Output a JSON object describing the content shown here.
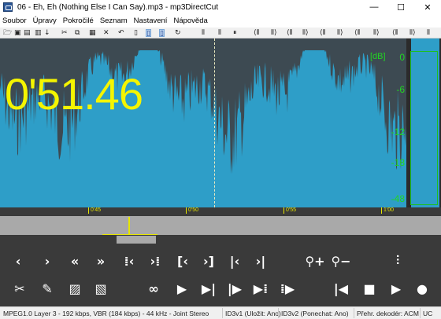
{
  "window": {
    "title": "06 - Eh, Eh (Nothing Else I Can Say).mp3 - mp3DirectCut",
    "minimize": "—",
    "maximize": "☐",
    "close": "✕"
  },
  "menu": [
    {
      "label": "Soubor"
    },
    {
      "label": "Úpravy"
    },
    {
      "label": "Pokročilé"
    },
    {
      "label": "Seznam"
    },
    {
      "label": "Nastavení"
    },
    {
      "label": "Nápověda"
    }
  ],
  "display": {
    "position": "0'51.46",
    "meter_unit": "[dB]",
    "meter_scale": [
      "0",
      "-6",
      "-12",
      "-18",
      "-48"
    ]
  },
  "ruler": {
    "labels": [
      "0'45",
      "0'50",
      "0'55",
      "1'00"
    ]
  },
  "controls": {
    "row1": [
      {
        "name": "prev-frame-button",
        "icon": "chevron-left-icon",
        "glyph": "‹"
      },
      {
        "name": "next-frame-button",
        "icon": "chevron-right-icon",
        "glyph": "›"
      },
      {
        "name": "rewind-button",
        "icon": "double-chevron-left-icon",
        "glyph": "«"
      },
      {
        "name": "forward-button",
        "icon": "double-chevron-right-icon",
        "glyph": "»"
      },
      {
        "name": "go-to-selection-start-button",
        "icon": "bar-left-icon",
        "glyph": "⁞‹"
      },
      {
        "name": "go-to-selection-end-button",
        "icon": "bar-right-icon",
        "glyph": "›⁞"
      },
      {
        "name": "set-start-marker-button",
        "icon": "bracket-left-icon",
        "glyph": "[‹"
      },
      {
        "name": "set-end-marker-button",
        "icon": "bracket-right-icon",
        "glyph": "›]"
      },
      {
        "name": "go-to-begin-button",
        "icon": "skip-start-icon",
        "glyph": "|‹"
      },
      {
        "name": "go-to-end-button",
        "icon": "skip-end-icon",
        "glyph": "›|"
      },
      {
        "name": "zoom-in-button",
        "icon": "zoom-in-icon",
        "glyph": "⚲+"
      },
      {
        "name": "zoom-out-button",
        "icon": "zoom-out-icon",
        "glyph": "⚲−"
      },
      {
        "name": "level-button",
        "icon": "level-bars-icon",
        "glyph": "⫶"
      }
    ],
    "row2": [
      {
        "name": "cut-button",
        "icon": "scissors-icon",
        "glyph": "✂"
      },
      {
        "name": "edit-button",
        "icon": "pencil-icon",
        "glyph": "✎"
      },
      {
        "name": "fade-in-button",
        "icon": "fade-in-icon",
        "glyph": "▨"
      },
      {
        "name": "fade-out-button",
        "icon": "fade-out-icon",
        "glyph": "▧"
      },
      {
        "name": "loop-button",
        "icon": "infinity-icon",
        "glyph": "∞"
      },
      {
        "name": "play-selection-button",
        "icon": "play-selection-icon",
        "glyph": "▶"
      },
      {
        "name": "play-to-marker-button",
        "icon": "play-to-marker-icon",
        "glyph": "▶|"
      },
      {
        "name": "play-from-marker-button",
        "icon": "play-from-marker-icon",
        "glyph": "|▶"
      },
      {
        "name": "play-end-button",
        "icon": "play-end-icon",
        "glyph": "▶⁞"
      },
      {
        "name": "play-region-button",
        "icon": "play-region-icon",
        "glyph": "⁞▶"
      },
      {
        "name": "rewind-to-start-button",
        "icon": "skip-back-icon",
        "glyph": "|◀"
      },
      {
        "name": "stop-button",
        "icon": "stop-icon",
        "glyph": "■"
      },
      {
        "name": "play-button",
        "icon": "play-icon",
        "glyph": "▶"
      },
      {
        "name": "record-button",
        "icon": "record-icon",
        "glyph": "●"
      }
    ]
  },
  "status": {
    "format": "MPEG1.0 Layer 3 - 192 kbps, VBR (184 kbps) - 44 kHz - Joint Stereo",
    "id3v1": "ID3v1 (Uložit: Ano)",
    "id3v2": "ID3v2 (Ponechat: Ano)",
    "decoder": "Přehr. dekodér: ACM",
    "extra": "UC"
  },
  "colors": {
    "waveform_bg": "#2e9ec8",
    "waveform_peak": "#3d4a52",
    "time_display": "#f5f500",
    "meter": "#22d422"
  }
}
